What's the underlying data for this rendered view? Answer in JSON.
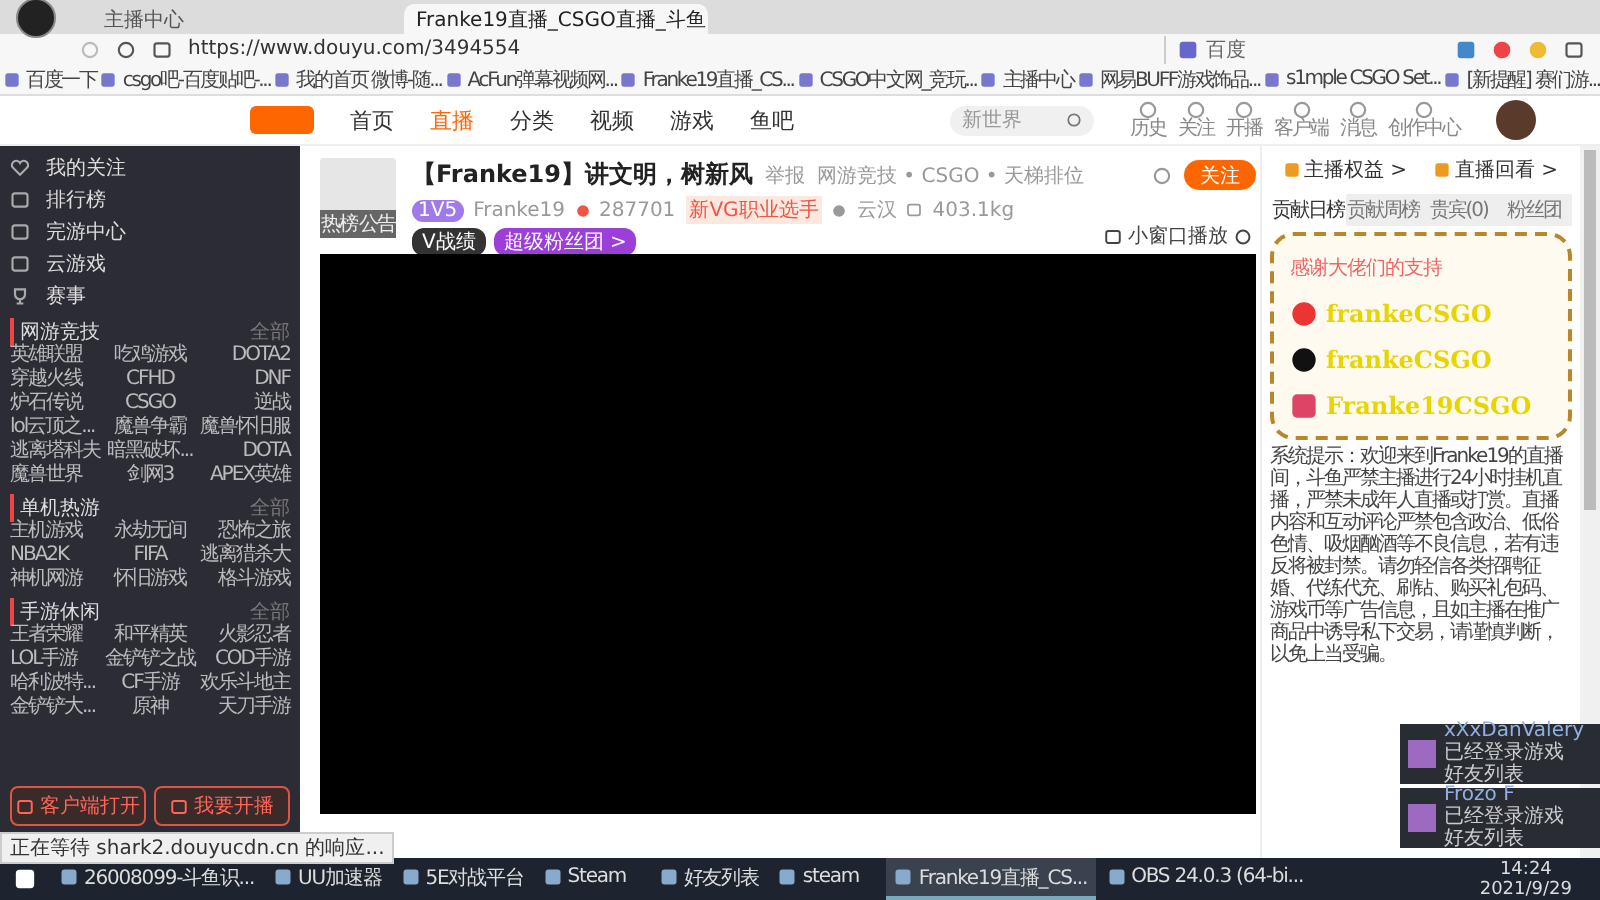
{
  "browser": {
    "tabs": [
      {
        "title": "主播中心",
        "selected": false
      },
      {
        "title": "Franke19直播_CSGO直播_斗鱼",
        "selected": true
      }
    ],
    "url": "https://www.douyu.com/3494554",
    "search_engine": "百度",
    "bookmarks": [
      "百度一下",
      "csgo吧-百度贴吧-...",
      "我的首页 微博-随...",
      "AcFun弹幕视频网...",
      "Franke19直播_CS...",
      "CSGO中文网_竞玩...",
      "主播中心",
      "网易BUFF游戏饰品...",
      "s1mple CSGO Set...",
      "[新提醒] 赛们游..."
    ]
  },
  "site_nav": {
    "items": [
      {
        "label": "首页",
        "selected": false
      },
      {
        "label": "直播",
        "selected": true
      },
      {
        "label": "分类",
        "selected": false
      },
      {
        "label": "视频",
        "selected": false
      },
      {
        "label": "游戏",
        "selected": false
      },
      {
        "label": "鱼吧",
        "selected": false
      }
    ],
    "search_placeholder": "新世界",
    "actions": [
      "历史",
      "关注",
      "开播",
      "客户端",
      "消息",
      "创作中心"
    ]
  },
  "sidebar": {
    "items": [
      "我的关注",
      "排行榜",
      "完游中心",
      "云游戏",
      "赛事"
    ],
    "sections": [
      {
        "title": "网游竞技",
        "more": "全部",
        "games": [
          "英雄联盟",
          "吃鸡游戏",
          "DOTA2",
          "穿越火线",
          "CFHD",
          "DNF",
          "炉石传说",
          "CSGO",
          "逆战",
          "lol云顶之...",
          "魔兽争霸",
          "魔兽怀旧服",
          "逃离塔科夫",
          "暗黑破坏...",
          "DOTA",
          "魔兽世界",
          "剑网3",
          "APEX英雄"
        ]
      },
      {
        "title": "单机热游",
        "more": "全部",
        "games": [
          "主机游戏",
          "永劫无间",
          "恐怖之旅",
          "NBA2K",
          "FIFA",
          "逃离猎杀大",
          "神机网游",
          "怀旧游戏",
          "格斗游戏"
        ]
      },
      {
        "title": "手游休闲",
        "more": "全部",
        "games": [
          "王者荣耀",
          "和平精英",
          "火影忍者",
          "LOL手游",
          "金铲铲之战",
          "COD手游",
          "哈利波特...",
          "CF手游",
          "欢乐斗地主",
          "金铲铲大...",
          "原神",
          "天刀手游"
        ]
      }
    ],
    "buttons": [
      "客户端打开",
      "我要开播"
    ]
  },
  "stream": {
    "thumb_labels": [
      "热榜",
      "公告"
    ],
    "title": "【Franke19】讲文明，树新风",
    "tag": "举报",
    "category": "网游竞技 • CSGO • 天梯排位",
    "level_badge": "1V5",
    "streamer": "Franke19",
    "heat": "287701",
    "honor": "新VG职业选手",
    "region": "云汉",
    "weight": "403.1kg",
    "badges": [
      "V战绩",
      "超级粉丝团 >"
    ],
    "follow": "关注",
    "mini_player": "小窗口播放"
  },
  "right_panel": {
    "tabs": [
      "主播权益 >",
      "直播回看 >"
    ],
    "rank_tabs": [
      {
        "label": "贡献日榜",
        "selected": true
      },
      {
        "label": "贡献周榜",
        "selected": false
      },
      {
        "label": "贵宾(0)",
        "selected": false
      },
      {
        "label": "粉丝团",
        "selected": false
      }
    ],
    "rank_hint": "感谢大佬们的支持",
    "overlay_handles": [
      "frankeCSGO",
      "frankeCSGO",
      "Franke19CSGO"
    ],
    "notice": "系统提示：欢迎来到Franke19的直播间，斗鱼严禁主播进行24小时挂机直播，严禁未成年人直播或打赏。直播内容和互动评论严禁包含政治、低俗色情、吸烟酗酒等不良信息，若有违反将被封禁。请勿轻信各类招聘征婚、代练代充、刷钻、购买礼包码、游戏币等广告信息，且如主播在推广商品中诱导私下交易，请谨慎判断，以免上当受骗。"
  },
  "notifications": [
    {
      "name": "xXxDanValery",
      "status": "已经登录游戏",
      "source": "好友列表"
    },
    {
      "name": "Frozo F",
      "status": "已经登录游戏",
      "source": "好友列表"
    }
  ],
  "status_text": "正在等待 shark2.douyucdn.cn 的响应...",
  "taskbar": {
    "items": [
      {
        "label": "26008099-斗鱼识...",
        "selected": false
      },
      {
        "label": "UU加速器",
        "selected": false
      },
      {
        "label": "5E对战平台",
        "selected": false
      },
      {
        "label": "Steam",
        "selected": false
      },
      {
        "label": "好友列表",
        "selected": false
      },
      {
        "label": "steam",
        "selected": false
      },
      {
        "label": "Franke19直播_CS...",
        "selected": true
      },
      {
        "label": "OBS 24.0.3 (64-bi...",
        "selected": false
      }
    ],
    "time": "14:24",
    "date": "2021/9/29"
  }
}
